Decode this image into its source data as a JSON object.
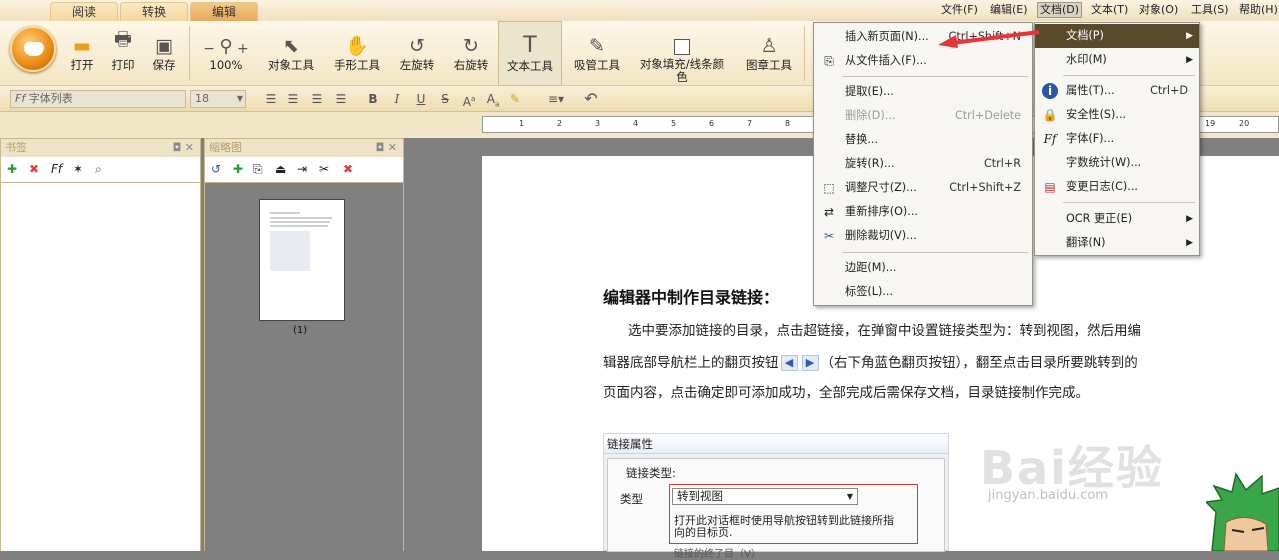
{
  "tabs": [
    "阅读",
    "转换",
    "编辑"
  ],
  "menubar": [
    "文件(F)",
    "编辑(E)",
    "文档(D)",
    "文本(T)",
    "对象(O)",
    "工具(S)",
    "帮助(H)"
  ],
  "ribbon": {
    "open": "打开",
    "print": "打印",
    "save": "保存",
    "zoom": "100%",
    "object_tool": "对象工具",
    "hand_tool": "手形工具",
    "rotate_left": "左旋转",
    "rotate_right": "右旋转",
    "text_tool": "文本工具",
    "eyedropper": "吸管工具",
    "fill_line": "对象填充/线条颜色",
    "stamp_tool": "图章工具"
  },
  "format": {
    "font_placeholder": "字体列表",
    "font_size": "18"
  },
  "ruler": [
    "1",
    "2",
    "3",
    "4",
    "5",
    "6",
    "7",
    "8",
    "19",
    "20"
  ],
  "panels": {
    "bookmarks": "书签",
    "thumbnails": "缩略图",
    "page_label": "(1)"
  },
  "doc": {
    "heading": "编辑器中制作目录链接：",
    "para1": "选中要添加链接的目录，点击超链接，在弹窗中设置链接类型为：转到视图，然后用编",
    "para2a": "辑器底部导航栏上的翻页按钮",
    "para2b": "（右下角蓝色翻页按钮），翻至点击目录所要跳转到的",
    "para3": "页面内容，点击确定即可添加成功，全部完成后需保存文档，目录链接制作完成。"
  },
  "dialog": {
    "title": "链接属性",
    "group": "链接类型:",
    "type_label": "类型",
    "type_value": "转到视图",
    "hint1": "打开此对话框时使用导航按钮转到此链接所指",
    "hint2": "向的目标页.",
    "checkbox": "链接的终了目（V）"
  },
  "doc_menu": [
    {
      "label": "插入新页面(N)...",
      "shortcut": "Ctrl+Shift+N"
    },
    {
      "label": "从文件插入(F)...",
      "shortcut": ""
    },
    {
      "label": "提取(E)...",
      "shortcut": ""
    },
    {
      "label": "删除(D)...",
      "shortcut": "Ctrl+Delete"
    },
    {
      "label": "替换...",
      "shortcut": ""
    },
    {
      "label": "旋转(R)...",
      "shortcut": "Ctrl+R"
    },
    {
      "label": "调整尺寸(Z)...",
      "shortcut": "Ctrl+Shift+Z"
    },
    {
      "label": "重新排序(O)...",
      "shortcut": ""
    },
    {
      "label": "删除裁切(V)...",
      "shortcut": ""
    },
    {
      "label": "边距(M)...",
      "shortcut": ""
    },
    {
      "label": "标签(L)...",
      "shortcut": ""
    }
  ],
  "doc_submenu": [
    {
      "label": "文档(P)",
      "shortcut": ""
    },
    {
      "label": "水印(M)",
      "shortcut": ""
    },
    {
      "label": "属性(T)...",
      "shortcut": "Ctrl+D"
    },
    {
      "label": "安全性(S)...",
      "shortcut": ""
    },
    {
      "label": "字体(F)...",
      "shortcut": ""
    },
    {
      "label": "字数统计(W)...",
      "shortcut": ""
    },
    {
      "label": "变更日志(C)...",
      "shortcut": ""
    },
    {
      "label": "OCR 更正(E)",
      "shortcut": ""
    },
    {
      "label": "翻译(N)",
      "shortcut": ""
    }
  ],
  "watermark": {
    "logo": "Bai经验",
    "url": "jingyan.baidu.com"
  },
  "colors": {
    "accent": "#e8a85c",
    "highlight": "#5a4a2c",
    "arrow": "#e8323c"
  }
}
